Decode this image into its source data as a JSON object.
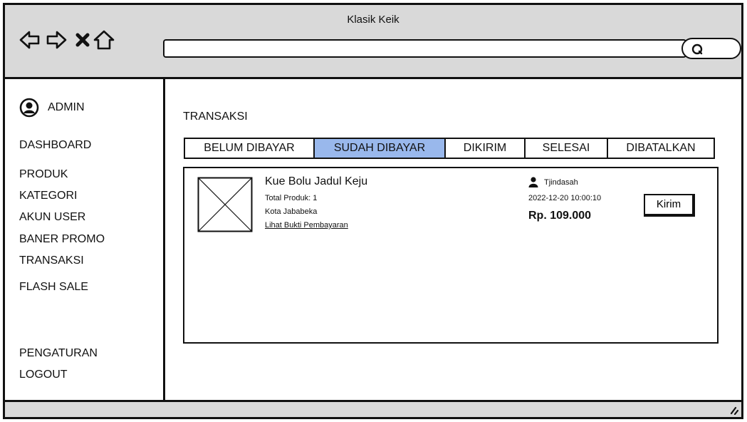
{
  "window": {
    "title": "Klasik Keik",
    "url": ""
  },
  "sidebar": {
    "user": "ADMIN",
    "items": [
      {
        "label": "DASHBOARD"
      },
      {
        "label": "PRODUK"
      },
      {
        "label": "KATEGORI"
      },
      {
        "label": "AKUN USER"
      },
      {
        "label": "BANER PROMO"
      },
      {
        "label": "TRANSAKSI"
      },
      {
        "label": "FLASH SALE"
      },
      {
        "label": "PENGATURAN"
      },
      {
        "label": "LOGOUT"
      }
    ]
  },
  "main": {
    "title": "TRANSAKSI",
    "tabs": [
      {
        "label": "BELUM DIBAYAR",
        "active": false
      },
      {
        "label": "SUDAH DIBAYAR",
        "active": true
      },
      {
        "label": "DIKIRIM",
        "active": false
      },
      {
        "label": "SELESAI",
        "active": false
      },
      {
        "label": "DIBATALKAN",
        "active": false
      }
    ],
    "order": {
      "product_name": "Kue Bolu Jadul Keju",
      "total_products": "Total Produk: 1",
      "city": "Kota Jababeka",
      "proof_link": "Lihat Bukti Pembayaran",
      "buyer": "Tjindasah",
      "datetime": "2022-12-20  10:00:10",
      "price": "Rp. 109.000",
      "action": "Kirim"
    }
  },
  "icons": {
    "back": "arrow-left-icon",
    "forward": "arrow-right-icon",
    "stop": "close-icon",
    "home": "home-icon",
    "search": "search-icon",
    "user": "user-icon",
    "avatar": "avatar-icon",
    "placeholder": "image-placeholder-icon",
    "resize": "resize-grip-icon"
  },
  "colors": {
    "active_tab": "#99b8ec",
    "chrome": "#d9d9d9"
  }
}
